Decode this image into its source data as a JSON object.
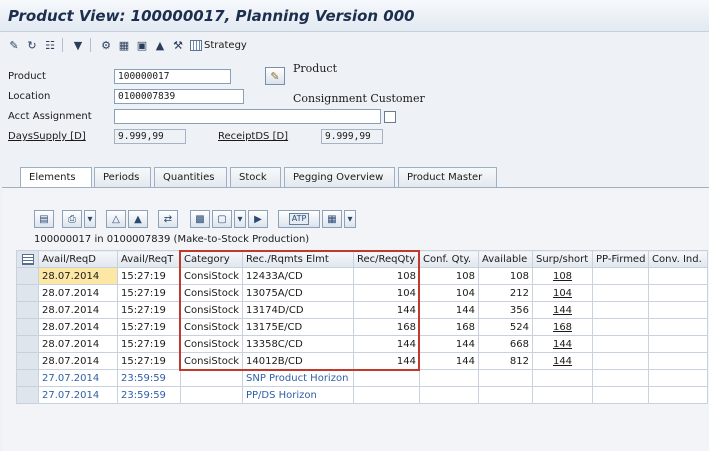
{
  "window": {
    "title": "Product View: 100000017, Planning Version 000"
  },
  "toolbar": {
    "strategy_label": "Strategy"
  },
  "header": {
    "product_label": "Product",
    "product_value": "100000017",
    "product_desc": "Product",
    "location_label": "Location",
    "location_value": "0100007839",
    "location_desc": "Consignment Customer",
    "acct_label": "Acct Assignment",
    "acct_value": "",
    "days_supply_label": "DaysSupply [D]",
    "days_supply_value": "9.999,99",
    "receipt_ds_label": "ReceiptDS [D]",
    "receipt_ds_value": "9.999,99"
  },
  "tabs": [
    "Elements",
    "Periods",
    "Quantities",
    "Stock",
    "Pegging Overview",
    "Product Master"
  ],
  "app_toolbar": {
    "atp_label": "ATP"
  },
  "context_line": "100000017 in 0100007839 (Make-to-Stock Production)",
  "table": {
    "columns": [
      "Avail/ReqD",
      "Avail/ReqT",
      "Category",
      "Rec./Rqmts Elmt",
      "Rec/ReqQty",
      "Conf. Qty.",
      "Available",
      "Surp/short",
      "PP-Firmed",
      "Conv. Ind."
    ],
    "rows": [
      [
        "28.07.2014",
        "15:27:19",
        "ConsiStock",
        "12433A/CD",
        "108",
        "108",
        "108",
        "108",
        "",
        ""
      ],
      [
        "28.07.2014",
        "15:27:19",
        "ConsiStock",
        "13075A/CD",
        "104",
        "104",
        "212",
        "104",
        "",
        ""
      ],
      [
        "28.07.2014",
        "15:27:19",
        "ConsiStock",
        "13174D/CD",
        "144",
        "144",
        "356",
        "144",
        "",
        ""
      ],
      [
        "28.07.2014",
        "15:27:19",
        "ConsiStock",
        "13175E/CD",
        "168",
        "168",
        "524",
        "168",
        "",
        ""
      ],
      [
        "28.07.2014",
        "15:27:19",
        "ConsiStock",
        "13358C/CD",
        "144",
        "144",
        "668",
        "144",
        "",
        ""
      ],
      [
        "28.07.2014",
        "15:27:19",
        "ConsiStock",
        "14012B/CD",
        "144",
        "144",
        "812",
        "144",
        "",
        ""
      ],
      [
        "27.07.2014",
        "23:59:59",
        "",
        "SNP Product Horizon",
        "",
        "",
        "",
        "",
        "",
        ""
      ],
      [
        "27.07.2014",
        "23:59:59",
        "",
        "PP/DS Horizon",
        "",
        "",
        "",
        "",
        "",
        ""
      ]
    ]
  },
  "colors": {
    "highlight_cell": "#fde7a5",
    "horizon_text": "#2f5fa8",
    "callout_box": "#c0392b"
  }
}
